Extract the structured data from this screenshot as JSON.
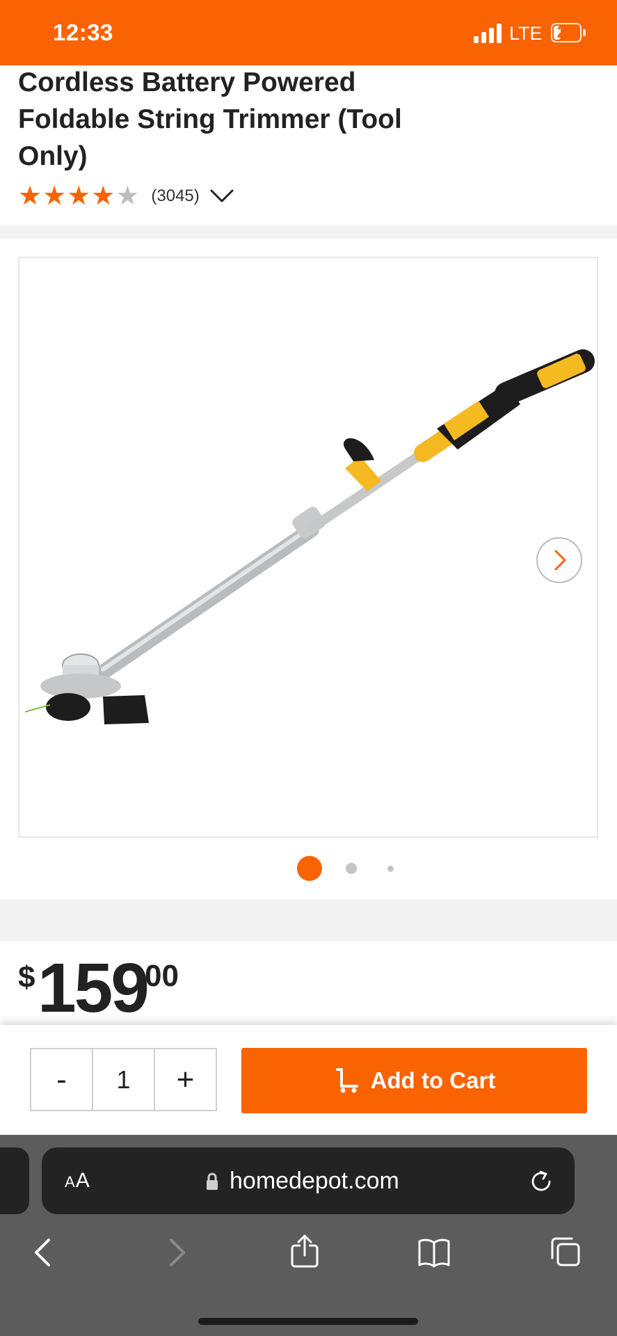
{
  "status_bar": {
    "time": "12:33",
    "network": "LTE",
    "battery_level": "27",
    "battery_fraction": 0.27,
    "bg_color": "#f96302"
  },
  "product": {
    "title": "Cordless Battery Powered Foldable String Trimmer (Tool Only)",
    "rating": 4,
    "rating_max": 5,
    "review_count": "(3045)"
  },
  "gallery": {
    "image_count": 3,
    "current_index": 0,
    "next_icon": "chevron-right-icon"
  },
  "price": {
    "currency": "$",
    "dollars": "159",
    "cents": "00"
  },
  "cart": {
    "qty_minus": "-",
    "quantity": "1",
    "qty_plus": "+",
    "add_label": "Add to Cart",
    "accent": "#f96302"
  },
  "browser": {
    "text_size_large": "A",
    "text_size_small": "A",
    "url": "homedepot.com",
    "nav_icons": [
      "back-icon",
      "forward-icon",
      "share-icon",
      "bookmarks-icon",
      "tabs-icon"
    ]
  }
}
